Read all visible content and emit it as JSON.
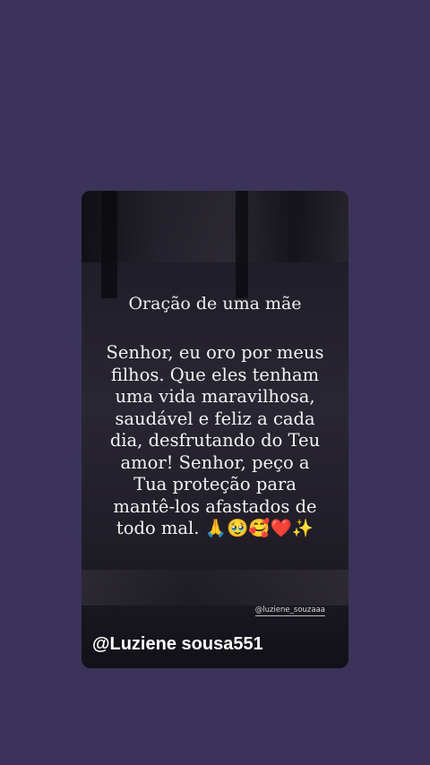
{
  "story": {
    "title": "Oração de uma mãe",
    "lines": [
      "Senhor, eu oro por meus",
      "filhos. Que eles tenham",
      "uma vida maravilhosa,",
      "saudável e feliz a cada",
      "dia, desfrutando do Teu",
      "amor! Senhor, peço a",
      "Tua proteção para",
      "mantê-los afastados de",
      "todo mal. 🙏🥹🥰❤️✨"
    ],
    "credit": "@luziene_souzaaa",
    "handle": "@Luziene sousa551"
  },
  "colors": {
    "background": "#3b3359",
    "text": "#f2f2f2"
  }
}
